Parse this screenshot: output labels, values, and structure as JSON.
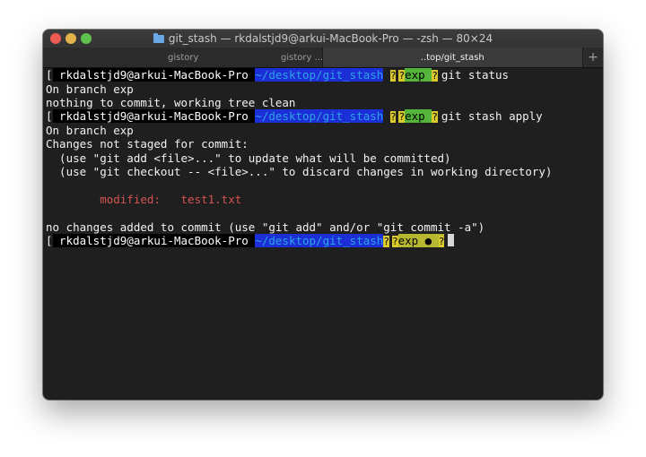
{
  "window": {
    "title": "git_stash — rkdalstjd9@arkui-MacBook-Pro — -zsh — 80×24",
    "folder_icon": "folder-icon"
  },
  "tabs": [
    {
      "label": "gistory",
      "active": false
    },
    {
      "label": "gistory ...",
      "active": false
    },
    {
      "label": "..top/git_stash",
      "active": true
    }
  ],
  "new_tab_label": "+",
  "prompt": {
    "user": " rkdalstjd9@arkui-MacBook-Pro ",
    "path": "~/desktop/git_stash",
    "branch": "exp",
    "dirty_marker": "●",
    "q": "?",
    "bracket": "["
  },
  "terminal": {
    "cmd1": "git status",
    "out1": [
      "On branch exp",
      "nothing to commit, working tree clean"
    ],
    "cmd2": "git stash apply",
    "out2": [
      "On branch exp",
      "Changes not staged for commit:",
      "  (use \"git add <file>...\" to update what will be committed)",
      "  (use \"git checkout -- <file>...\" to discard changes in working directory)"
    ],
    "modified_label": "        modified:   test1.txt",
    "out3": "no changes added to commit (use \"git add\" and/or \"git commit -a\")"
  },
  "colors": {
    "path_bg": "#1c2fd6",
    "branch_bg": "#55b43a",
    "branch_dirty_bg": "#b7b730",
    "modified": "#d55453"
  }
}
